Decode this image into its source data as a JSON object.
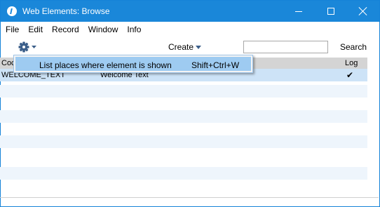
{
  "window": {
    "title": "Web Elements: Browse"
  },
  "menubar": {
    "items": [
      "File",
      "Edit",
      "Record",
      "Window",
      "Info"
    ]
  },
  "toolbar": {
    "operations_icon": "gear-icon",
    "create_label": "Create",
    "search_value": "",
    "search_label": "Search"
  },
  "list": {
    "columns": {
      "code": "Coc",
      "log": "Log"
    },
    "rows": [
      {
        "code": "WELCOME_TEXT",
        "name": "Welcome Text",
        "log": "✔"
      }
    ]
  },
  "dropdown": {
    "items": [
      {
        "label": "List places where element is shown",
        "shortcut": "Shift+Ctrl+W"
      }
    ]
  },
  "colors": {
    "titlebar": "#1a87d9",
    "selection": "#cde3f7",
    "menu_highlight": "#9ecbf1"
  }
}
